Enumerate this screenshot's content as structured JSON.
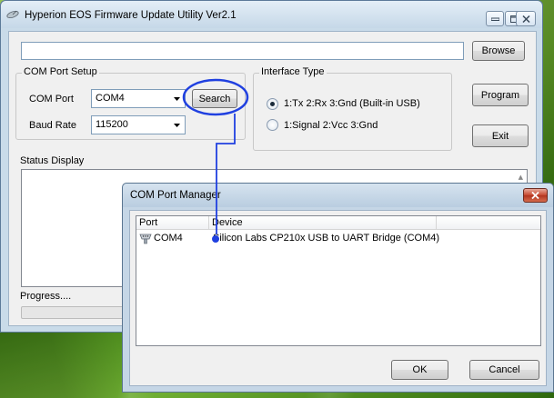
{
  "main_window": {
    "title": "Hyperion EOS Firmware Update Utility Ver2.1",
    "path_input_value": "",
    "browse_label": "Browse",
    "program_label": "Program",
    "exit_label": "Exit",
    "com_setup": {
      "title": "COM Port Setup",
      "com_port_label": "COM Port",
      "com_port_value": "COM4",
      "search_label": "Search",
      "baud_label": "Baud Rate",
      "baud_value": "115200"
    },
    "interface_type": {
      "title": "Interface Type",
      "options": [
        {
          "label": "1:Tx 2:Rx 3:Gnd (Built-in USB)",
          "checked": true
        },
        {
          "label": "1:Signal 2:Vcc 3:Gnd",
          "checked": false
        }
      ]
    },
    "status_label": "Status Display",
    "progress_label": "Progress...."
  },
  "dialog": {
    "title": "COM Port Manager",
    "columns": [
      "Port",
      "Device"
    ],
    "rows": [
      {
        "port": "COM4",
        "device": "Silicon Labs CP210x USB to UART Bridge (COM4)"
      }
    ],
    "ok_label": "OK",
    "cancel_label": "Cancel"
  },
  "colors": {
    "annotation": "#2040e0",
    "desktop_green": "#6aa72c",
    "window_frame": "#c9dbe9"
  },
  "icons": {
    "app": "satellite-dish-icon",
    "port": "serial-port-icon"
  }
}
